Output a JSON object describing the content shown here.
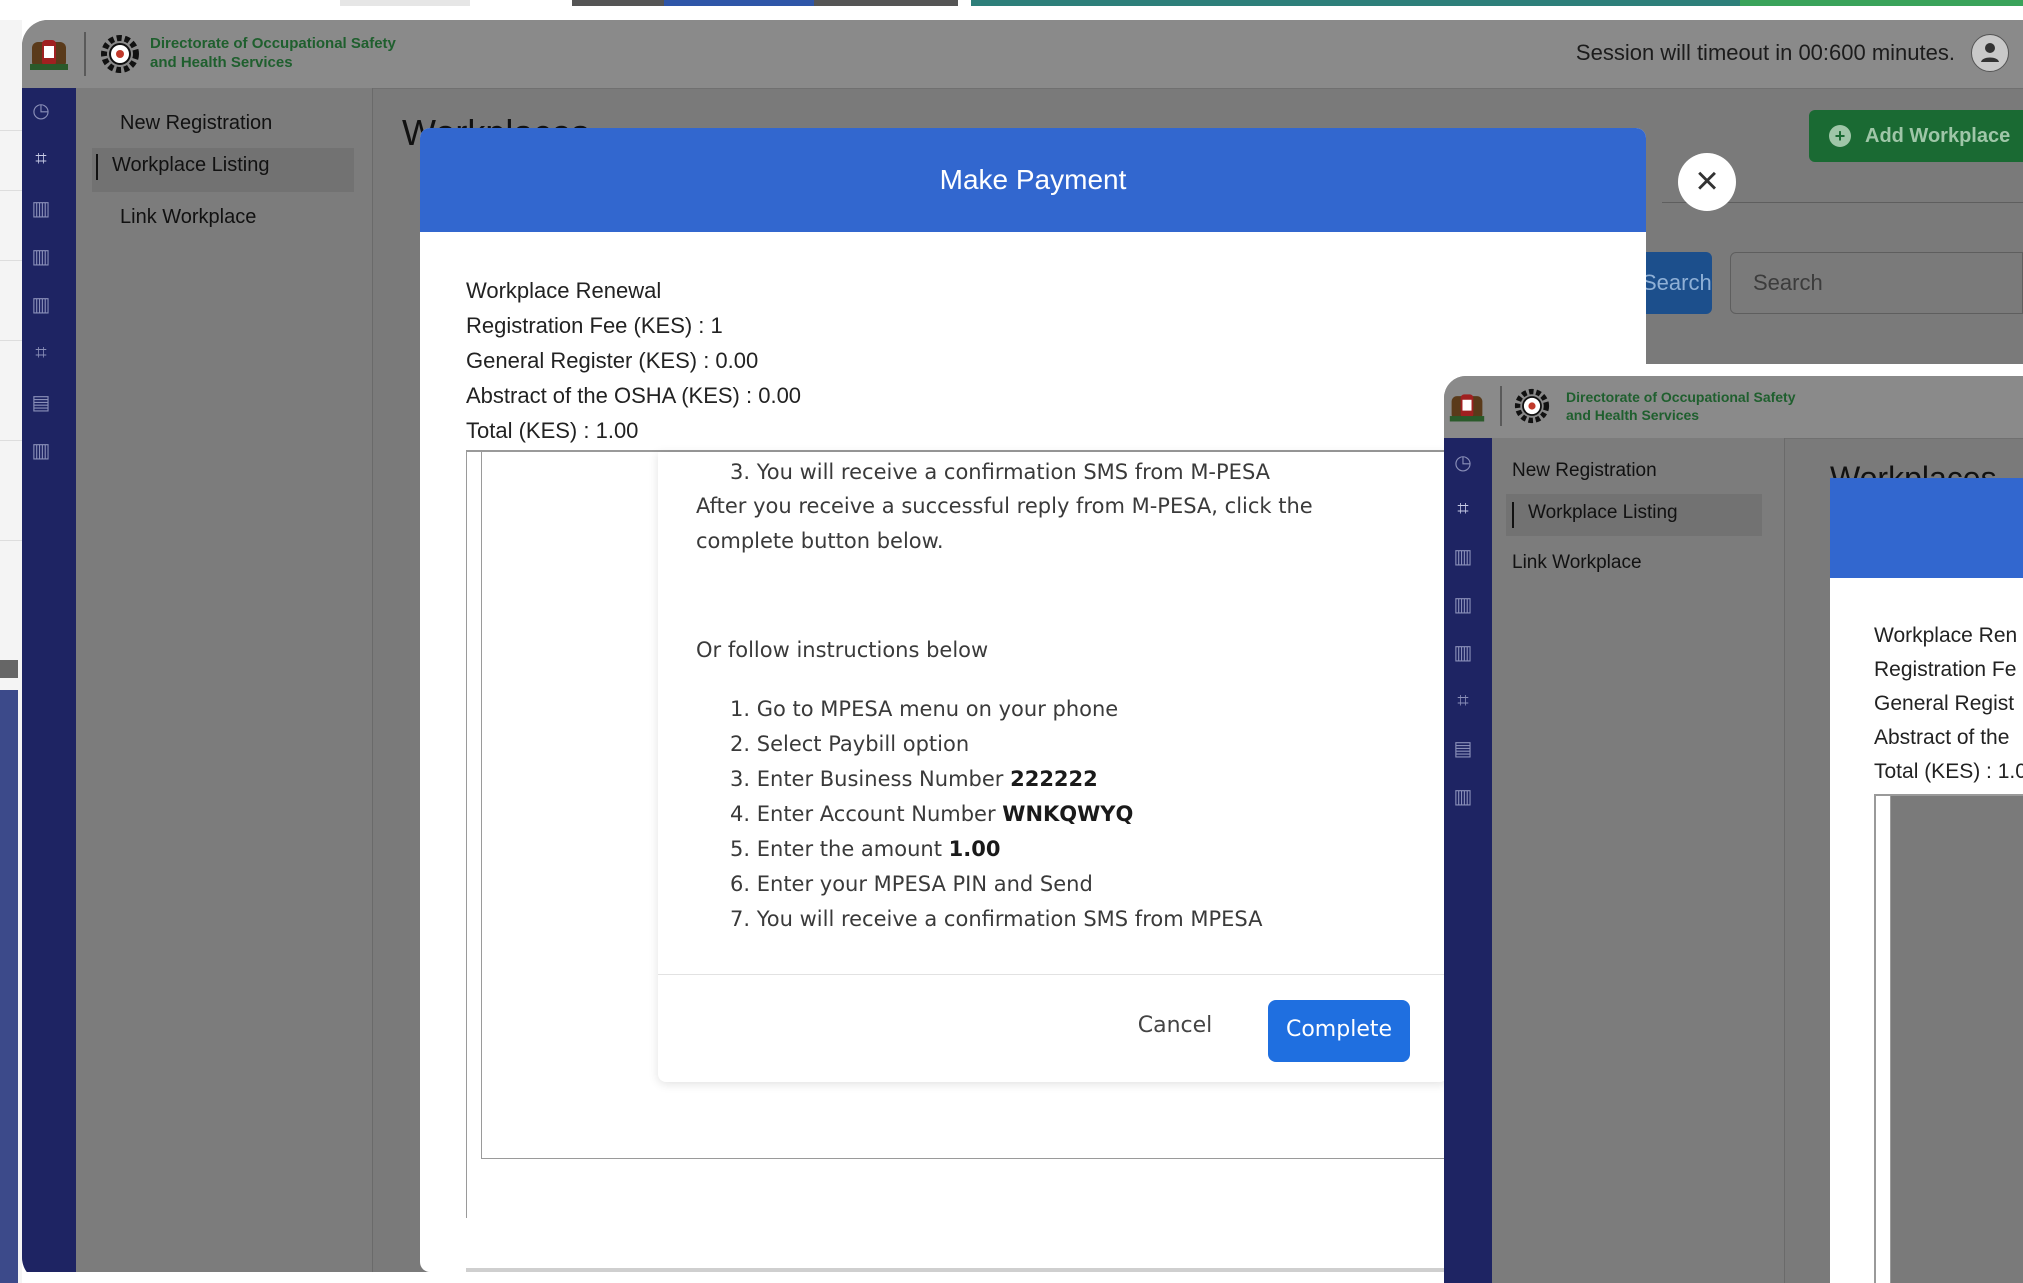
{
  "org": {
    "name_line1": "Directorate of Occupational Safety",
    "name_line2": "and Health Services"
  },
  "header": {
    "session_text": "Session will timeout in 00:600 minutes."
  },
  "sidebar": {
    "items": [
      {
        "label": "New Registration"
      },
      {
        "label": "Workplace Listing"
      },
      {
        "label": "Link Workplace"
      }
    ]
  },
  "main": {
    "title": "Workplaces",
    "add_button": "Add Workplace",
    "search_button": "Search",
    "search_placeholder": "Search"
  },
  "modal": {
    "title": "Make Payment",
    "close_icon": "close-icon",
    "info_lines": [
      "Workplace Renewal",
      "Registration Fee (KES) : 1",
      "General Register (KES) : 0.00",
      "Abstract of the OSHA (KES) : 0.00",
      "Total (KES) : 1.00"
    ],
    "stk_step3": "3. You will receive a confirmation SMS from M-PESA",
    "after_reply_1": "After you receive a successful reply from M-PESA, click the",
    "after_reply_2": "complete button below.",
    "or_follow": "Or follow instructions below",
    "steps": [
      {
        "num": "1.",
        "text": "Go to MPESA menu on your phone",
        "bold": ""
      },
      {
        "num": "2.",
        "text": "Select Paybill option",
        "bold": ""
      },
      {
        "num": "3.",
        "text": "Enter Business Number ",
        "bold": "222222"
      },
      {
        "num": "4.",
        "text": "Enter Account Number ",
        "bold": "WNKQWYQ"
      },
      {
        "num": "5.",
        "text": "Enter the amount ",
        "bold": "1.00"
      },
      {
        "num": "6.",
        "text": "Enter your MPESA PIN and Send",
        "bold": ""
      },
      {
        "num": "7.",
        "text": "You will receive a confirmation SMS from MPESA",
        "bold": ""
      }
    ],
    "cancel_label": "Cancel",
    "complete_label": "Complete"
  },
  "second_window": {
    "info_lines": [
      "Workplace Ren",
      "Registration Fe",
      "General Regist",
      "Abstract of the",
      "Total (KES) : 1.0"
    ]
  },
  "colors": {
    "modal_header": "#3267cf",
    "complete_button": "#1f6fe0",
    "rail": "#1e2463",
    "org_text": "#1f5f2e"
  }
}
